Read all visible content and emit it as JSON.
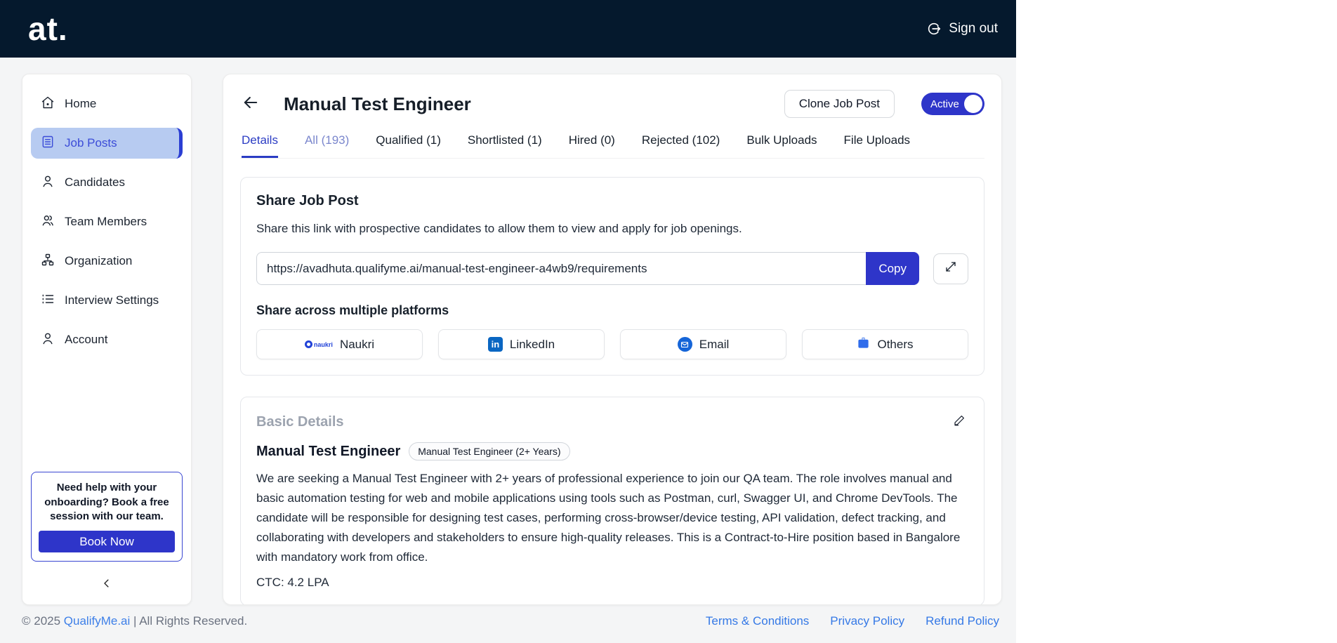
{
  "header": {
    "logo": "at.",
    "sign_out": "Sign out"
  },
  "sidebar": {
    "items": [
      {
        "label": "Home"
      },
      {
        "label": "Job Posts"
      },
      {
        "label": "Candidates"
      },
      {
        "label": "Team Members"
      },
      {
        "label": "Organization"
      },
      {
        "label": "Interview Settings"
      },
      {
        "label": "Account"
      }
    ],
    "help_box": {
      "text": "Need help with your onboarding? Book a free session with our team.",
      "button": "Book Now"
    }
  },
  "page": {
    "title": "Manual Test Engineer",
    "clone_button": "Clone Job Post",
    "status_toggle": {
      "label": "Active",
      "state": "on"
    },
    "tabs": [
      {
        "label": "Details"
      },
      {
        "label": "All (193)"
      },
      {
        "label": "Qualified (1)"
      },
      {
        "label": "Shortlisted (1)"
      },
      {
        "label": "Hired (0)"
      },
      {
        "label": "Rejected (102)"
      },
      {
        "label": "Bulk Uploads"
      },
      {
        "label": "File Uploads"
      }
    ]
  },
  "share_card": {
    "title": "Share Job Post",
    "description": "Share this link with prospective candidates to allow them to view and apply for job openings.",
    "link": "https://avadhuta.qualifyme.ai/manual-test-engineer-a4wb9/requirements",
    "copy_button": "Copy",
    "platforms_title": "Share across multiple platforms",
    "platforms": [
      {
        "label": "Naukri",
        "logo_text": "naukri"
      },
      {
        "label": "LinkedIn",
        "logo_text": "in"
      },
      {
        "label": "Email"
      },
      {
        "label": "Others"
      }
    ]
  },
  "details_card": {
    "title": "Basic Details",
    "job_title": "Manual Test Engineer",
    "badge": "Manual Test Engineer (2+ Years)",
    "description": "We are seeking a Manual Test Engineer with 2+ years of professional experience to join our QA team. The role involves manual and basic automation testing for web and mobile applications using tools such as Postman, curl, Swagger UI, and Chrome DevTools. The candidate will be responsible for designing test cases, performing cross-browser/device testing, API validation, defect tracking, and collaborating with developers and stakeholders to ensure high-quality releases. This is a Contract-to-Hire position based in Bangalore with mandatory work from office.",
    "ctc": "CTC: 4.2 LPA"
  },
  "footer": {
    "copyright_prefix": "© 2025 ",
    "brand_link": "QualifyMe.ai",
    "copyright_suffix": " | All Rights Reserved.",
    "links": [
      {
        "label": "Terms & Conditions"
      },
      {
        "label": "Privacy Policy"
      },
      {
        "label": "Refund Policy"
      }
    ]
  },
  "colors": {
    "primary_blue": "#2e35c9",
    "header_navy": "#05192d",
    "active_nav_bg": "#b7cbf1",
    "active_nav_text": "#3b4cd8",
    "link_blue": "#3579e6",
    "linkedin_blue": "#0a66c2"
  }
}
